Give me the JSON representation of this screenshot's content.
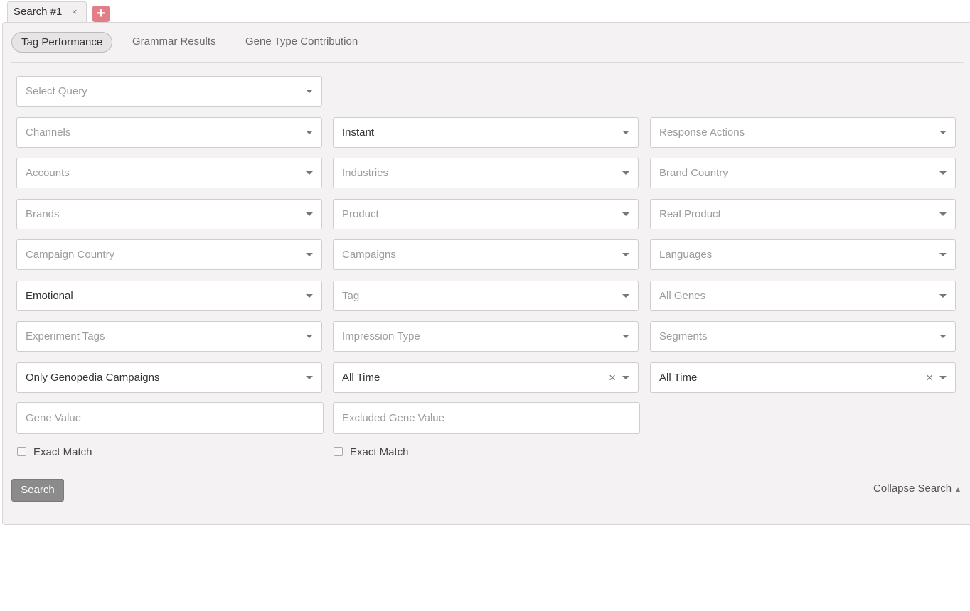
{
  "tabs": {
    "search_tab": "Search #1",
    "close_glyph": "×",
    "add_glyph": "+"
  },
  "subtabs": [
    "Tag Performance",
    "Grammar Results",
    "Gene Type Contribution"
  ],
  "query": {
    "placeholder": "Select Query"
  },
  "filters": {
    "channels": "Channels",
    "instant": "Instant",
    "response_actions": "Response Actions",
    "accounts": "Accounts",
    "industries": "Industries",
    "brand_country": "Brand Country",
    "brands": "Brands",
    "product": "Product",
    "real_product": "Real Product",
    "campaign_country": "Campaign Country",
    "campaigns": "Campaigns",
    "languages": "Languages",
    "emotional": "Emotional",
    "tag": "Tag",
    "all_genes": "All Genes",
    "experiment_tags": "Experiment Tags",
    "impression_type": "Impression Type",
    "segments": "Segments",
    "only_genopedia": "Only Genopedia Campaigns",
    "time_1": "All Time",
    "time_2": "All Time",
    "clear_glyph": "×"
  },
  "gene_value": {
    "placeholder": "Gene Value"
  },
  "excluded_gene_value": {
    "placeholder": "Excluded Gene Value"
  },
  "exact_match_label": "Exact Match",
  "search_button": "Search",
  "collapse_search": "Collapse Search",
  "collapse_glyph": "▲"
}
